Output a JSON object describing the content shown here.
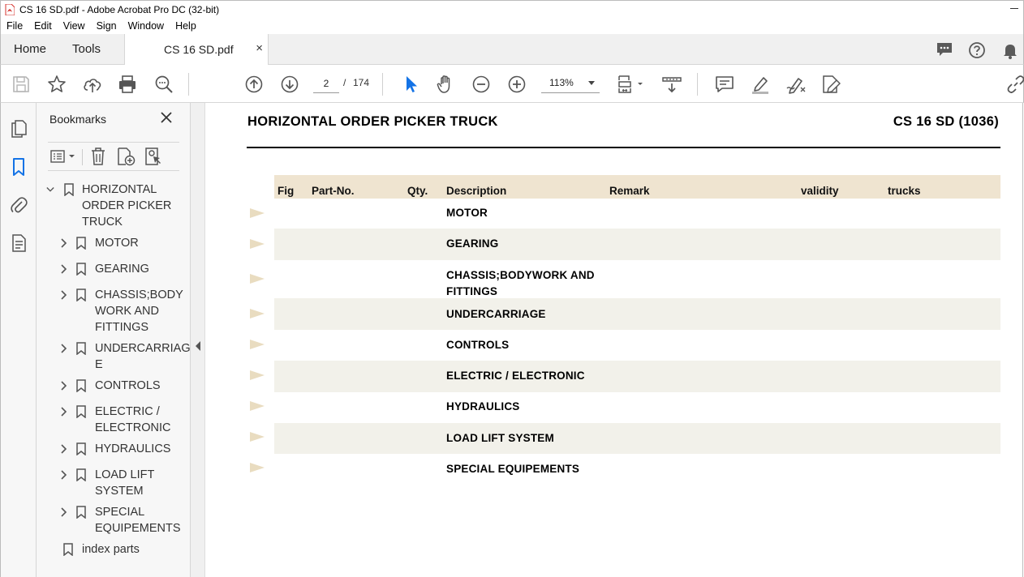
{
  "window": {
    "title": "CS 16 SD.pdf - Adobe Acrobat Pro DC (32-bit)"
  },
  "menu": [
    "File",
    "Edit",
    "View",
    "Sign",
    "Window",
    "Help"
  ],
  "tabs": {
    "home": "Home",
    "tools": "Tools",
    "document": "CS 16 SD.pdf",
    "close": "×"
  },
  "toolbar": {
    "page_current": "2",
    "page_separator": "/",
    "page_total": "174",
    "zoom": "113%"
  },
  "bookmarks": {
    "title": "Bookmarks",
    "root": "HORIZONTAL\nORDER PICKER\nTRUCK",
    "items": [
      "MOTOR",
      "GEARING",
      "CHASSIS;BODY\nWORK AND\nFITTINGS",
      "UNDERCARRIAG\nE",
      "CONTROLS",
      "ELECTRIC /\nELECTRONIC",
      "HYDRAULICS",
      "LOAD LIFT\nSYSTEM",
      "SPECIAL\nEQUIPEMENTS"
    ],
    "index": "index parts"
  },
  "document": {
    "title": "HORIZONTAL ORDER PICKER TRUCK",
    "model": "CS 16 SD (1036)",
    "columns": [
      "Fig",
      "Part-No.",
      "Qty.",
      "Description",
      "Remark",
      "validity",
      "trucks"
    ],
    "rows": [
      "MOTOR",
      "GEARING",
      "CHASSIS;BODYWORK AND\nFITTINGS",
      "UNDERCARRIAGE",
      "CONTROLS",
      "ELECTRIC / ELECTRONIC",
      "HYDRAULICS",
      "LOAD LIFT SYSTEM",
      "SPECIAL EQUIPEMENTS"
    ]
  },
  "colors": {
    "accent_blue": "#1473e6",
    "header_beige": "#efe4d0",
    "row_shade": "#f2f1ea",
    "marker": "#e9dcc0",
    "pdf_red": "#d4302b"
  }
}
